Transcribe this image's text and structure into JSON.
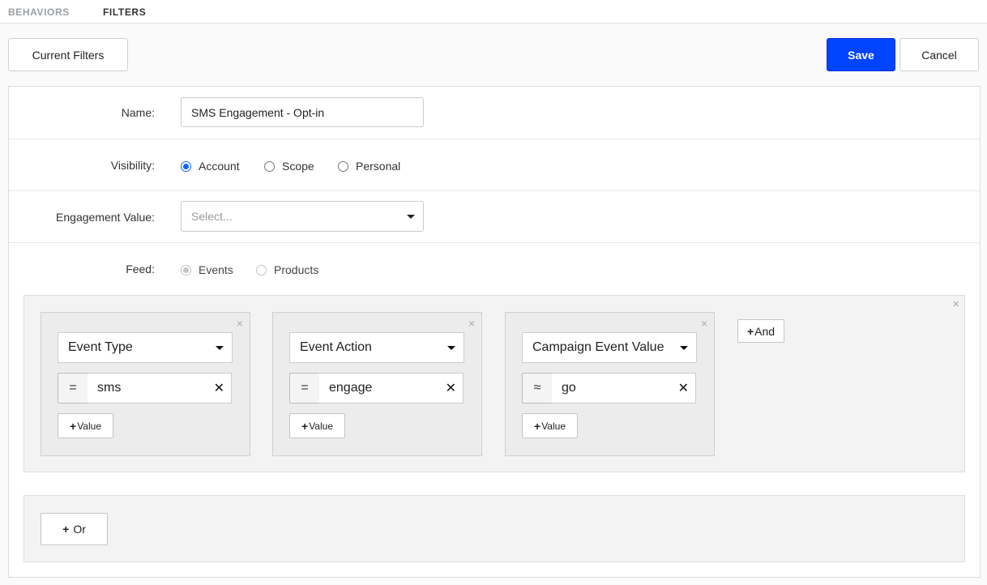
{
  "nav": {
    "tabs": [
      {
        "label": "BEHAVIORS"
      },
      {
        "label": "FILTERS"
      }
    ]
  },
  "toolbar": {
    "current_filters_label": "Current Filters",
    "save_label": "Save",
    "cancel_label": "Cancel"
  },
  "form": {
    "name_label": "Name:",
    "name_value": "SMS Engagement - Opt-in",
    "visibility_label": "Visibility:",
    "visibility_options": [
      {
        "label": "Account",
        "selected": true
      },
      {
        "label": "Scope",
        "selected": false
      },
      {
        "label": "Personal",
        "selected": false
      }
    ],
    "engagement_label": "Engagement Value:",
    "engagement_placeholder": "Select...",
    "feed_label": "Feed:",
    "feed_options": [
      {
        "label": "Events",
        "selected": true
      },
      {
        "label": "Products",
        "selected": false
      }
    ]
  },
  "conditions": [
    {
      "field": "Event Type",
      "operator": "=",
      "value": "sms",
      "add_value_label": "Value"
    },
    {
      "field": "Event Action",
      "operator": "=",
      "value": "engage",
      "add_value_label": "Value"
    },
    {
      "field": "Campaign Event Value",
      "operator": "≈",
      "value": "go",
      "add_value_label": "Value"
    }
  ],
  "group": {
    "and_label": "And",
    "or_label": "Or"
  },
  "icons": {
    "close": "×",
    "clear": "✕",
    "plus": "+"
  },
  "colors": {
    "accent": "#0044ff",
    "radio": "#0a66ff"
  }
}
